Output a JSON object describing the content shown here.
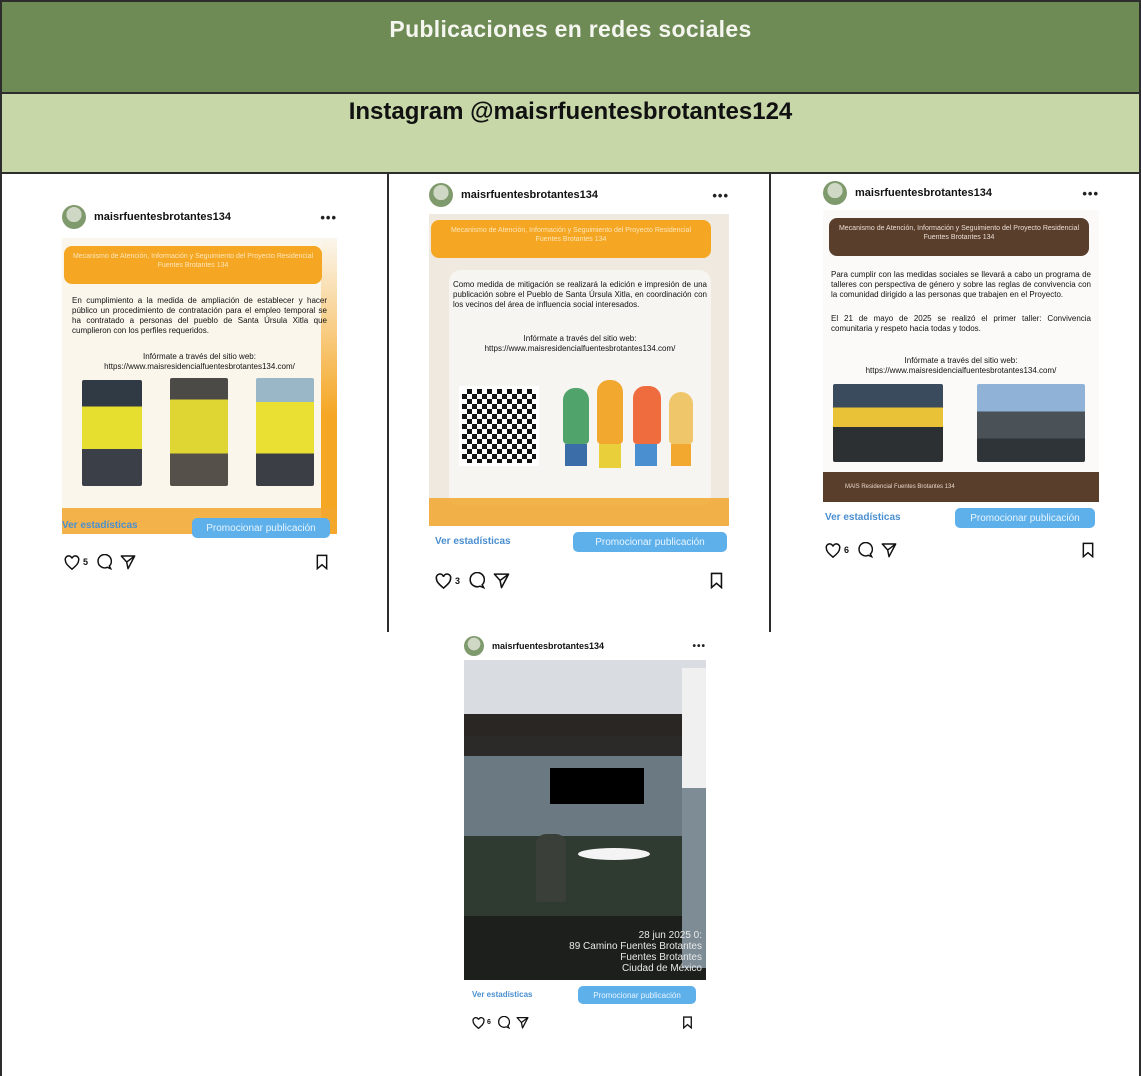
{
  "header": {
    "title": "Publicaciones en redes sociales",
    "subtitle": "Instagram @maisrfuentesbrotantes124"
  },
  "posts": [
    {
      "username": "maisrfuentesbrotantes134",
      "banner": "Mecanismo de Atención, Información y Seguimiento del Proyecto Residencial Fuentes Brotantes 134",
      "body": "En cumplimiento a la medida de ampliación de establecer y hacer público un procedimiento de contratación para el empleo temporal se ha contratado a personas del pueblo de Santa Úrsula Xitla que cumplieron con los perfiles requeridos.",
      "info_label": "Infórmate a través del sitio web:",
      "info_url": "https://www.maisresidencialfuentesbrotantes134.com/",
      "stats_label": "Ver estadísticas",
      "promo_label": "Promocionar publicación",
      "likes": "5"
    },
    {
      "username": "maisrfuentesbrotantes134",
      "banner": "Mecanismo de Atención, Información y Seguimiento del Proyecto Residencial Fuentes Brotantes 134",
      "body": "Como medida de mitigación se realizará la edición e impresión de una publicación sobre el Pueblo de Santa Úrsula Xitla, en coordinación con los vecinos del área de influencia social interesados.",
      "info_label": "Infórmate a través del sitio web:",
      "info_url": "https://www.maisresidencialfuentesbrotantes134.com/",
      "stats_label": "Ver estadísticas",
      "promo_label": "Promocionar publicación",
      "likes": "3"
    },
    {
      "username": "maisrfuentesbrotantes134",
      "banner": "Mecanismo de Atención, Información y Seguimiento del Proyecto Residencial Fuentes Brotantes 134",
      "body": "Para cumplir con las medidas sociales se llevará a cabo un programa de talleres con perspectiva de género y sobre las reglas de convivencia con la comunidad dirigido a las personas que trabajen en el Proyecto.",
      "body2": "El 21 de mayo de 2025 se realizó el primer taller: Convivencia comunitaria y respeto hacia todas y todos.",
      "info_label": "Infórmate a través del sitio web:",
      "info_url": "https://www.maisresidencialfuentesbrotantes134.com/",
      "footer_left": "MAIS Residencial Fuentes Brotantes 134",
      "stats_label": "Ver estadísticas",
      "promo_label": "Promocionar publicación",
      "likes": "6"
    },
    {
      "username": "maisrfuentesbrotantes134",
      "stamp_line1": "28 jun 2025 0:",
      "stamp_line2": "89 Camino Fuentes Brotantes",
      "stamp_line3": "Fuentes Brotantes",
      "stamp_line4": "Ciudad de México",
      "stats_label": "Ver estadísticas",
      "promo_label": "Promocionar publicación",
      "likes": "6"
    }
  ],
  "colors": {
    "header_band": "#6e8a55",
    "subheader_band": "#c7d7a8",
    "banner_orange": "#f5a623",
    "banner_brown": "#5a3e2c",
    "promo_blue": "#5db0ea",
    "stats_blue": "#4a8fd0"
  }
}
